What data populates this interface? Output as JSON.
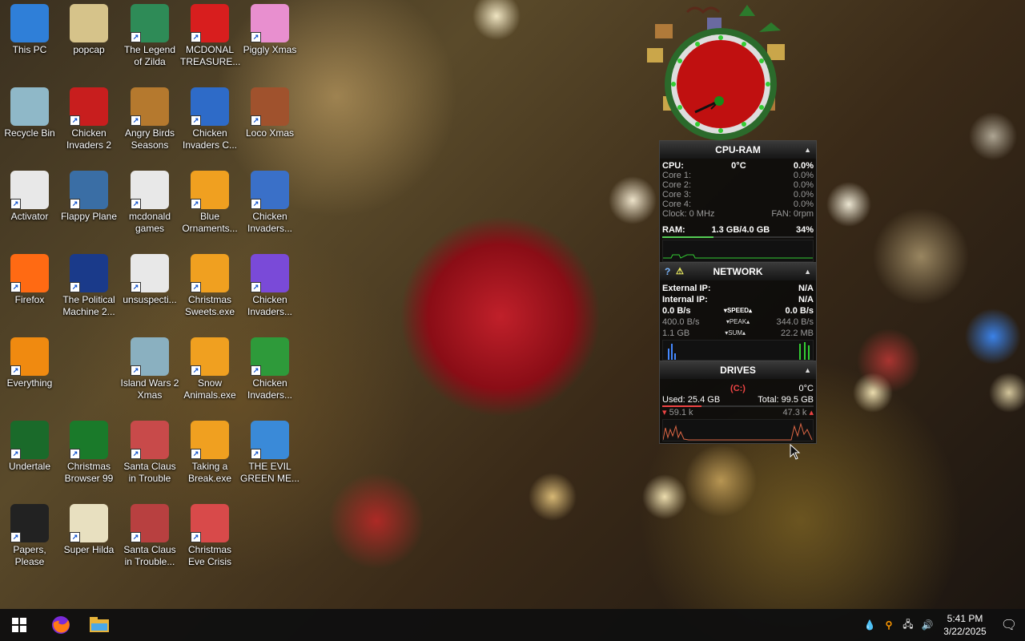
{
  "desktop": {
    "icons": [
      {
        "label": "This PC",
        "icon": "computer-icon",
        "color": "#2f7fd8"
      },
      {
        "label": "popcap",
        "icon": "folder-icon",
        "color": "#d6c38a"
      },
      {
        "label": "The Legend of Zilda",
        "icon": "game-icon",
        "color": "#2e8b57"
      },
      {
        "label": "MCDONAL TREASURE...",
        "icon": "mcdonalds-icon",
        "color": "#d81e1e"
      },
      {
        "label": "Piggly Xmas",
        "icon": "pig-icon",
        "color": "#e88fcf"
      },
      {
        "label": "Recycle Bin",
        "icon": "recycle-bin-icon",
        "color": "#8fb8c8"
      },
      {
        "label": "Chicken Invaders 2",
        "icon": "chicken-icon",
        "color": "#c81e1e"
      },
      {
        "label": "Angry Birds Seasons",
        "icon": "angry-birds-icon",
        "color": "#b5792e"
      },
      {
        "label": "Chicken Invaders C...",
        "icon": "chicken-icon",
        "color": "#2e6bc8"
      },
      {
        "label": "Loco Xmas",
        "icon": "bear-icon",
        "color": "#a0522d"
      },
      {
        "label": "Activator",
        "icon": "file-icon",
        "color": "#e8e8e8"
      },
      {
        "label": "Flappy Plane",
        "icon": "game-icon",
        "color": "#3a6ea5"
      },
      {
        "label": "mcdonald games",
        "icon": "file-icon",
        "color": "#e8e8e8"
      },
      {
        "label": "Blue Ornaments...",
        "icon": "installer-icon",
        "color": "#f0a020"
      },
      {
        "label": "Chicken Invaders...",
        "icon": "chicken-icon",
        "color": "#3a70c8"
      },
      {
        "label": "Firefox",
        "icon": "firefox-icon",
        "color": "#ff6a13"
      },
      {
        "label": "The Political Machine 2...",
        "icon": "game-icon",
        "color": "#1a3a8a"
      },
      {
        "label": "unsuspecti...",
        "icon": "file-icon",
        "color": "#e8e8e8"
      },
      {
        "label": "Christmas Sweets.exe",
        "icon": "installer-icon",
        "color": "#f0a020"
      },
      {
        "label": "Chicken Invaders...",
        "icon": "chicken-icon",
        "color": "#7a4ad8"
      },
      {
        "label": "Everything",
        "icon": "search-icon",
        "color": "#f08a10"
      },
      {
        "label": "Island Wars 2 Xmas",
        "icon": "game-icon",
        "color": "#8ab0c0"
      },
      {
        "label": "Snow Animals.exe",
        "icon": "installer-icon",
        "color": "#f0a020"
      },
      {
        "label": "Chicken Invaders...",
        "icon": "chicken-icon",
        "color": "#2e9a3a"
      },
      {
        "label": "Undertale",
        "icon": "undertale-icon",
        "color": "#1a6a2a"
      },
      {
        "label": "Christmas Browser 99",
        "icon": "tree-icon",
        "color": "#1a7a2a"
      },
      {
        "label": "Santa Claus in Trouble",
        "icon": "santa-icon",
        "color": "#c84a4a"
      },
      {
        "label": "Taking a Break.exe",
        "icon": "installer-icon",
        "color": "#f0a020"
      },
      {
        "label": "THE EVIL GREEN ME...",
        "icon": "people-icon",
        "color": "#3a8ad8"
      },
      {
        "label": "Papers, Please",
        "icon": "papers-icon",
        "color": "#222222"
      },
      {
        "label": "Super Hilda",
        "icon": "game-icon",
        "color": "#e8e0c0"
      },
      {
        "label": "Santa Claus in Trouble...",
        "icon": "santa-icon",
        "color": "#b84040"
      },
      {
        "label": "Christmas Eve Crisis",
        "icon": "santa-icon",
        "color": "#d84a4a"
      }
    ]
  },
  "cpu_ram": {
    "title": "CPU-RAM",
    "cpu_label": "CPU:",
    "cpu_temp": "0°C",
    "cpu_pct": "0.0%",
    "cores": [
      {
        "label": "Core 1:",
        "value": "0.0%"
      },
      {
        "label": "Core 2:",
        "value": "0.0%"
      },
      {
        "label": "Core 3:",
        "value": "0.0%"
      },
      {
        "label": "Core 4:",
        "value": "0.0%"
      }
    ],
    "clock": "Clock: 0 MHz",
    "fan": "FAN: 0rpm",
    "ram_label": "RAM:",
    "ram_value": "1.3 GB/4.0 GB",
    "ram_pct": "34%"
  },
  "network": {
    "title": "NETWORK",
    "help": "?",
    "warn": "⚠",
    "external_label": "External IP:",
    "external_value": "N/A",
    "internal_label": "Internal IP:",
    "internal_value": "N/A",
    "speed_down": "0.0 B/s",
    "speed_label": "▾SPEED▴",
    "speed_up": "0.0 B/s",
    "peak_down": "400.0 B/s",
    "peak_label": "▾PEAK▴",
    "peak_up": "344.0 B/s",
    "sum_down": "1.1 GB",
    "sum_label": "▾SUM▴",
    "sum_up": "22.2 MB"
  },
  "drives": {
    "title": "DRIVES",
    "drive_letter": "(C:)",
    "temp": "0°C",
    "used": "Used: 25.4 GB",
    "total": "Total: 99.5 GB",
    "read": "59.1 k",
    "write": "47.3 k"
  },
  "taskbar": {
    "time": "5:41 PM",
    "date": "3/22/2025"
  }
}
